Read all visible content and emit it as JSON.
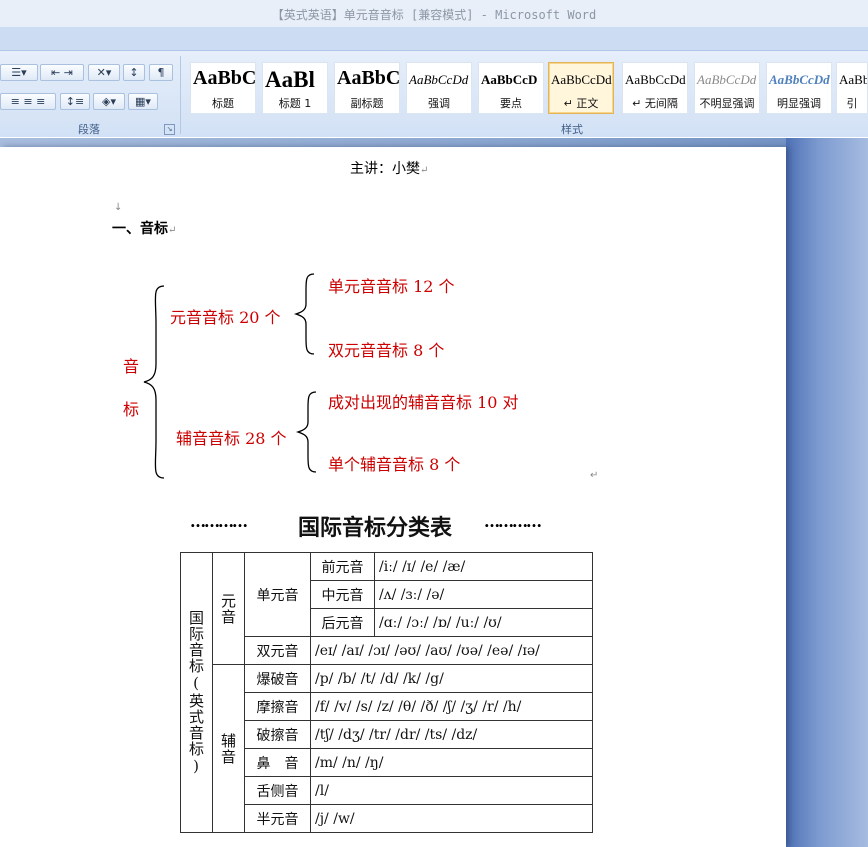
{
  "window": {
    "title": "【英式英语】单元音音标 [兼容模式] - Microsoft Word"
  },
  "ribbon": {
    "paragraph_group_label": "段落",
    "styles_group_label": "样式",
    "styles": [
      {
        "sample": "AaBbC",
        "name": "标题"
      },
      {
        "sample": "AaBl",
        "name": "标题 1"
      },
      {
        "sample": "AaBbC",
        "name": "副标题"
      },
      {
        "sample": "AaBbCcDd",
        "name": "强调"
      },
      {
        "sample": "AaBbCcD",
        "name": "要点"
      },
      {
        "sample": "AaBbCcDd",
        "name": "↵ 正文"
      },
      {
        "sample": "AaBbCcDd",
        "name": "↵ 无间隔"
      },
      {
        "sample": "AaBbCcDd",
        "name": "不明显强调"
      },
      {
        "sample": "AaBbCcDd",
        "name": "明显强调"
      },
      {
        "sample": "AaBb",
        "name": "引"
      }
    ]
  },
  "document": {
    "header_line": "主讲：小樊",
    "section_title": "一、音标",
    "tree": {
      "root_top": "音",
      "root_bottom": "标",
      "vowels": "元音音标 20 个",
      "monophthongs": "单元音音标 12 个",
      "diphthongs": "双元音音标 8 个",
      "consonants": "辅音音标 28 个",
      "paired": "成对出现的辅音音标 10 对",
      "single": "单个辅音音标 8 个"
    },
    "table_title": "国际音标分类表",
    "table_title_dots": "…………",
    "table": {
      "side_label": "国际音标(英式音标)",
      "vowel_label": "元音",
      "consonant_label": "辅音",
      "mono_label": "单元音",
      "rows": [
        {
          "type": "前元音",
          "symbols": "/iː/ /ɪ/ /e/ /æ/"
        },
        {
          "type": "中元音",
          "symbols": "/ʌ/ /ɜː/ /ə/"
        },
        {
          "type": "后元音",
          "symbols": "/ɑː/ /ɔː/ /ɒ/ /uː/ /ʊ/"
        },
        {
          "type": "双元音",
          "symbols": "/eɪ/ /aɪ/ /ɔɪ/ /əʊ/ /aʊ/ /ʊə/ /eə/ /ɪə/"
        },
        {
          "type": "爆破音",
          "symbols": "/p/ /b/ /t/ /d/ /k/ /g/"
        },
        {
          "type": "摩擦音",
          "symbols": "/f/ /v/ /s/ /z/ /θ/ /ð/ /ʃ/ /ʒ/ /r/ /h/"
        },
        {
          "type": "破擦音",
          "symbols": "/tʃ/ /dʒ/ /tr/ /dr/ /ts/ /dz/"
        },
        {
          "type": "鼻　音",
          "symbols": "/m/ /n/ /ŋ/"
        },
        {
          "type": "舌侧音",
          "symbols": "/l/"
        },
        {
          "type": "半元音",
          "symbols": "/j/ /w/"
        }
      ]
    }
  },
  "colors": {
    "accent_red": "#cc0000",
    "ribbon_blue": "#dbe7f6"
  }
}
